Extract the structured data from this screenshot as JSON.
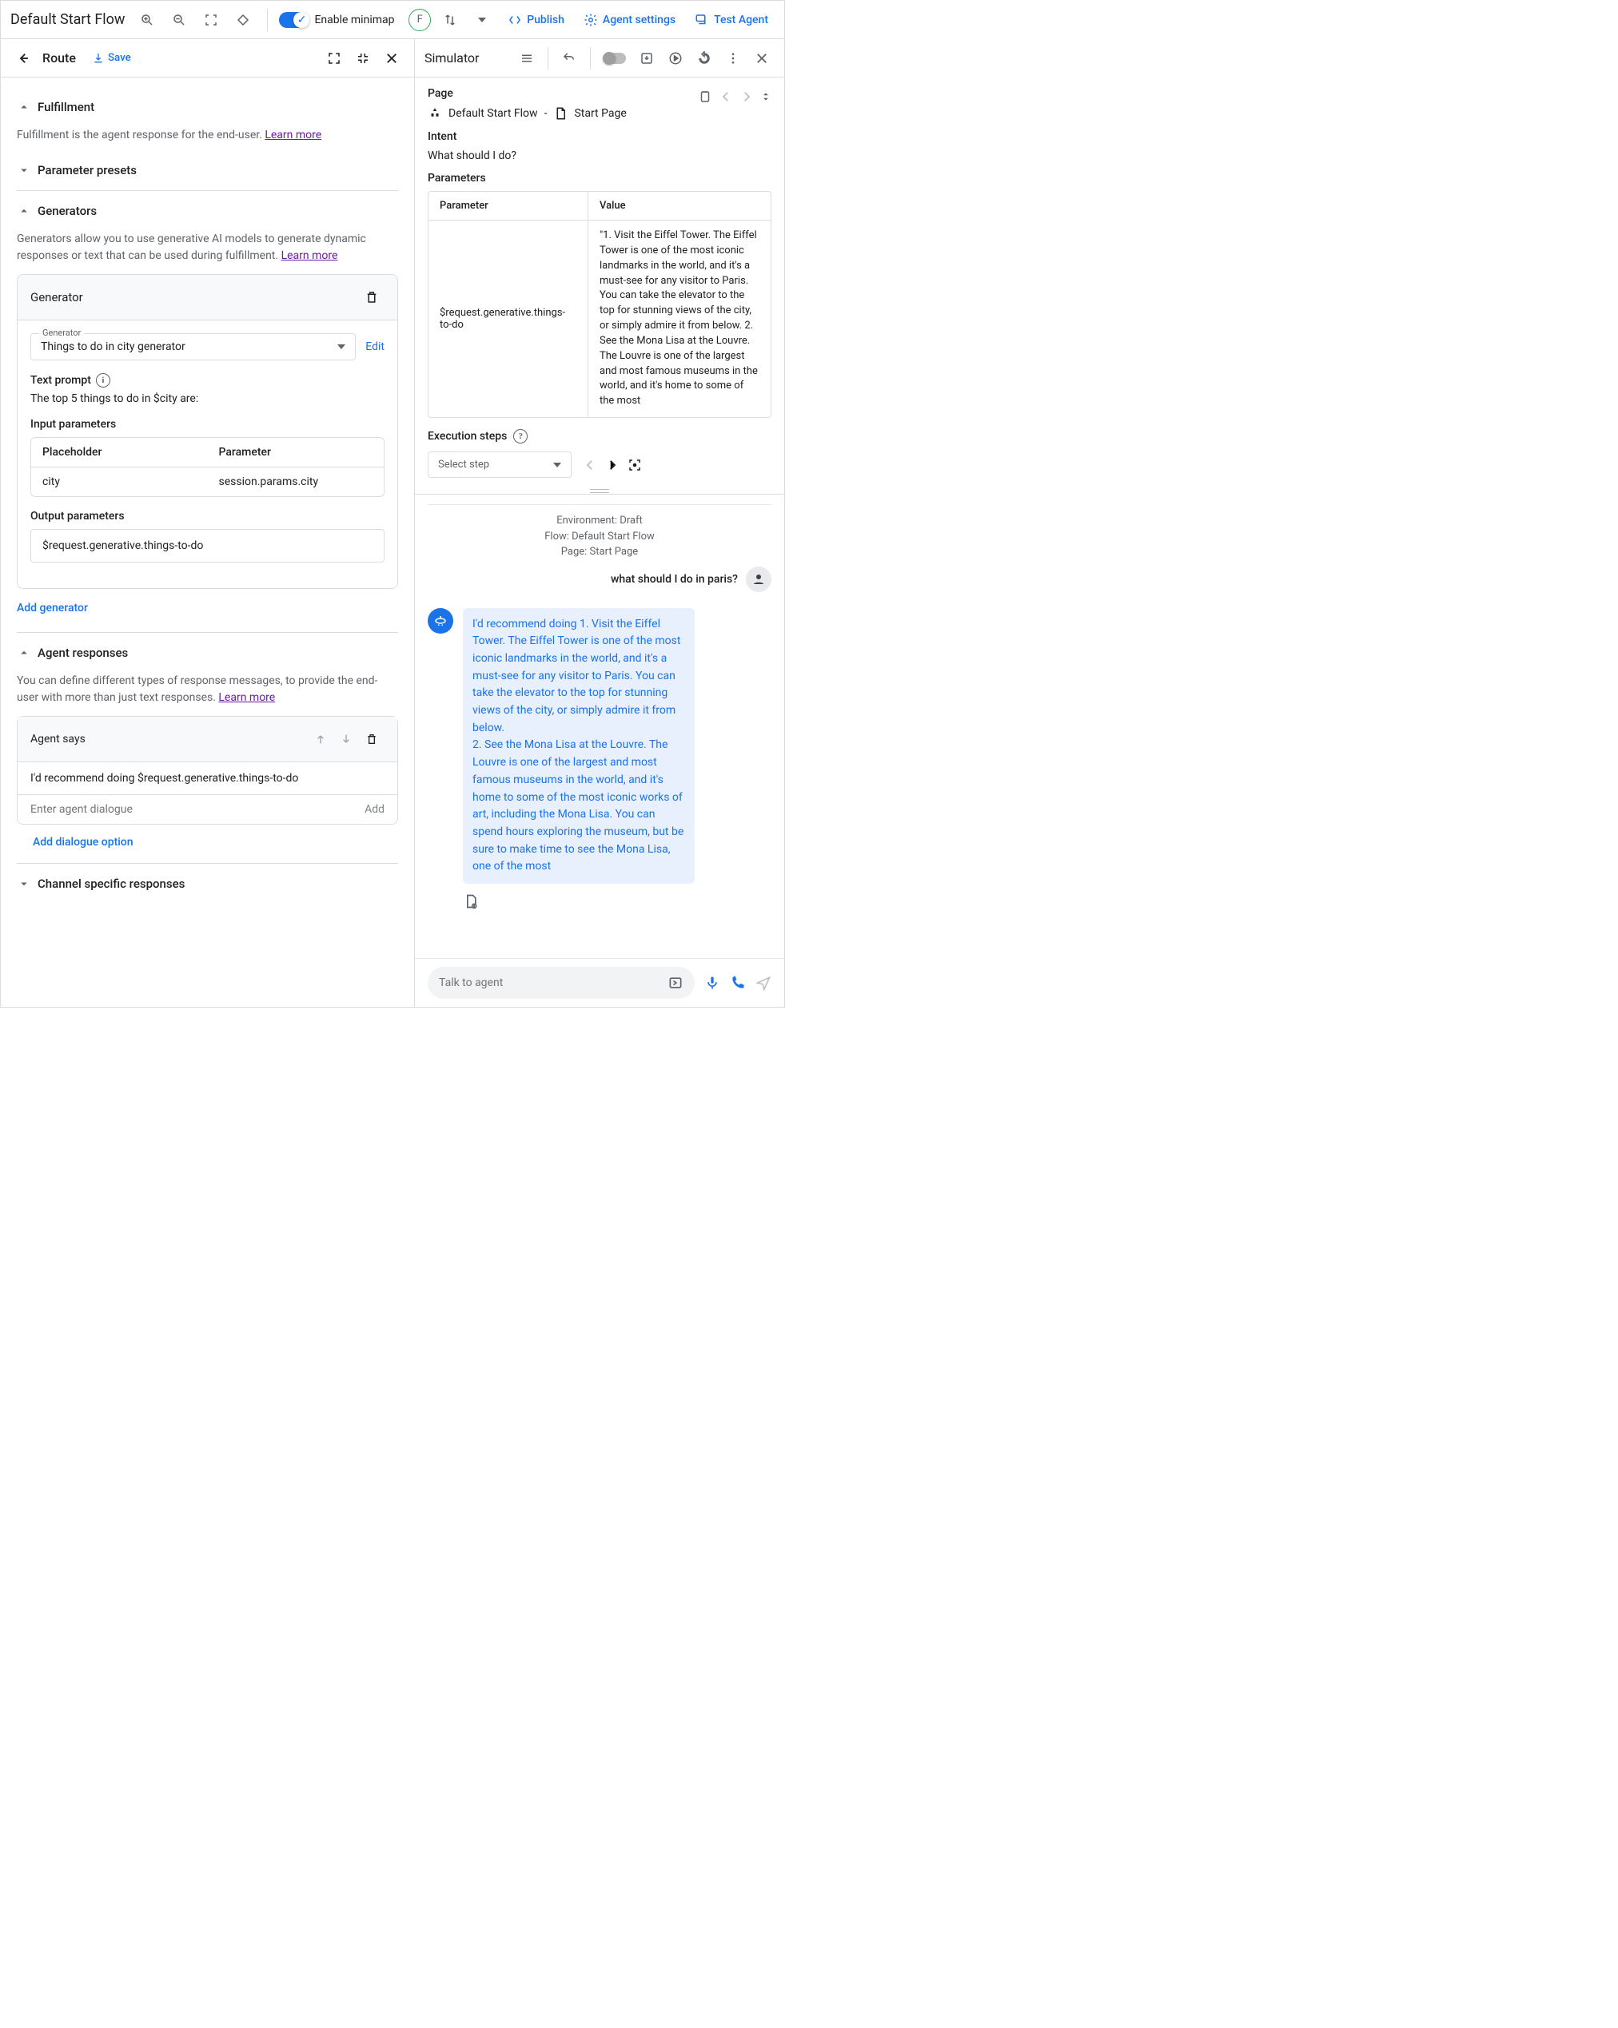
{
  "topbar": {
    "title": "Default Start Flow",
    "minimap_label": "Enable minimap",
    "avatar_letter": "F",
    "publish": "Publish",
    "agent_settings": "Agent settings",
    "test_agent": "Test Agent"
  },
  "left": {
    "route_title": "Route",
    "save": "Save",
    "fulfillment": {
      "title": "Fulfillment",
      "desc": "Fulfillment is the agent response for the end-user. ",
      "learn": "Learn more"
    },
    "param_presets": "Parameter presets",
    "generators": {
      "title": "Generators",
      "desc": "Generators allow you to use generative AI models to generate dynamic responses or text that can be used during fulfillment. ",
      "learn": "Learn more",
      "card_title": "Generator",
      "select_label": "Generator",
      "select_value": "Things to do in city generator",
      "edit": "Edit",
      "prompt_label": "Text prompt",
      "prompt_text": "The top 5 things to do in $city are:",
      "input_params_label": "Input parameters",
      "placeholder_h": "Placeholder",
      "parameter_h": "Parameter",
      "ph_value": "city",
      "param_value": "session.params.city",
      "output_params_label": "Output parameters",
      "output_value": "$request.generative.things-to-do",
      "add_generator": "Add generator"
    },
    "agent_responses": {
      "title": "Agent responses",
      "desc": "You can define different types of response messages, to provide the end-user with more than just text responses. ",
      "learn": "Learn more",
      "agent_says": "Agent says",
      "says_text": "I'd recommend doing  $request.generative.things-to-do",
      "enter_placeholder": "Enter agent dialogue",
      "add_btn": "Add",
      "add_dialogue": "Add dialogue option"
    },
    "channel_responses": "Channel specific responses"
  },
  "sim": {
    "title": "Simulator",
    "page_label": "Page",
    "crumb_flow": "Default Start Flow",
    "crumb_page": "Start Page",
    "intent_label": "Intent",
    "intent_value": "What should I do?",
    "params_label": "Parameters",
    "param_header": "Parameter",
    "value_header": "Value",
    "param_name": "$request.generative.things-to-do",
    "param_value": "\"1. Visit the Eiffel Tower. The Eiffel Tower is one of the most iconic landmarks in the world, and it's a must-see for any visitor to Paris. You can take the elevator to the top for stunning views of the city, or simply admire it from below. 2. See the Mona Lisa at the Louvre. The Louvre is one of the largest and most famous museums in the world, and it's home to some of the most",
    "exec_label": "Execution steps",
    "select_step": "Select step",
    "env": "Environment: Draft",
    "flow": "Flow: Default Start Flow",
    "pagectx": "Page: Start Page",
    "user_msg": "what should I do in paris?",
    "agent_reply": "I'd recommend doing 1. Visit the Eiffel Tower. The Eiffel Tower is one of the most iconic landmarks in the world, and it's a must-see for any visitor to Paris. You can take the elevator to the top for stunning views of the city, or simply admire it from below.\n2. See the Mona Lisa at the Louvre. The Louvre is one of the largest and most famous museums in the world, and it's home to some of the most iconic works of art, including the Mona Lisa. You can spend hours exploring the museum, but be sure to make time to see the Mona Lisa, one of the most",
    "input_placeholder": "Talk to agent"
  }
}
